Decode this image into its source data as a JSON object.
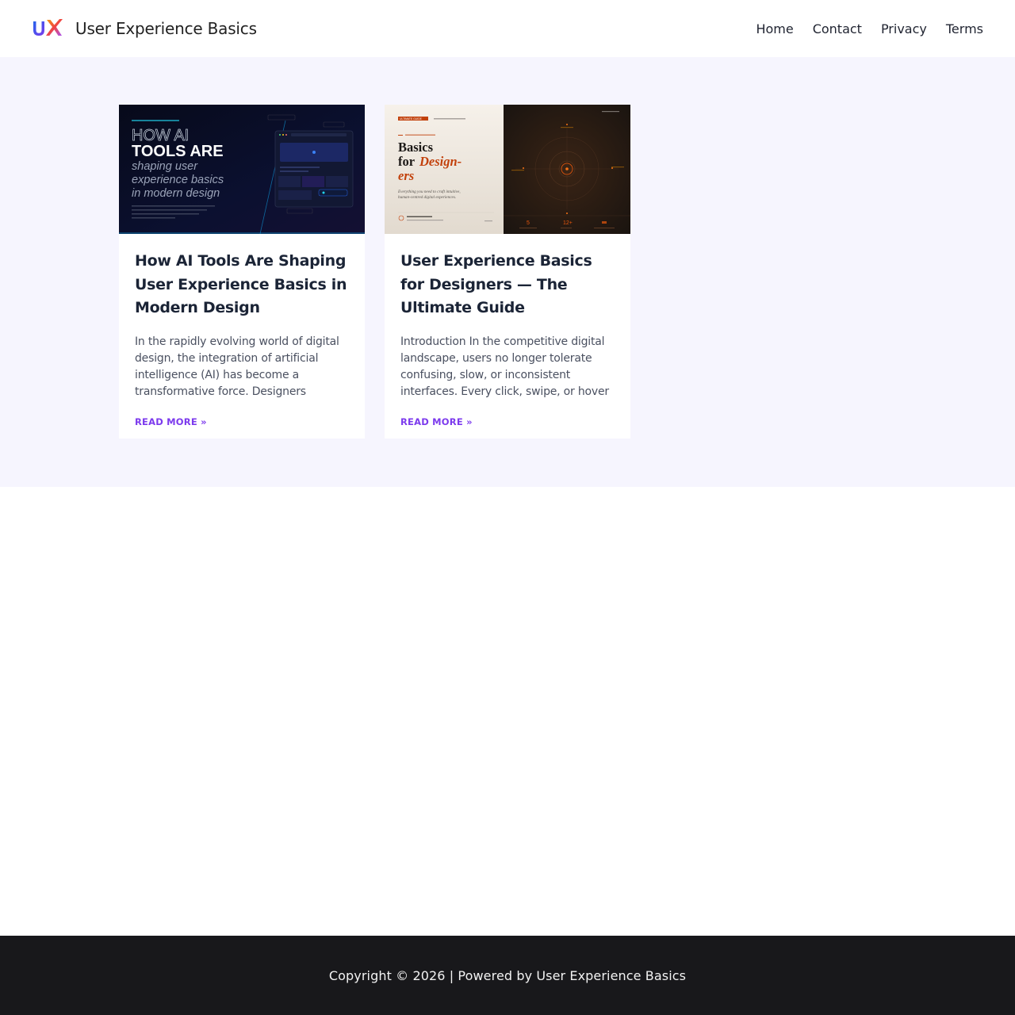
{
  "header": {
    "logo_text": "UX",
    "site_title": "User Experience Basics",
    "nav": [
      {
        "label": "Home"
      },
      {
        "label": "Contact"
      },
      {
        "label": "Privacy"
      },
      {
        "label": "Terms"
      }
    ]
  },
  "posts": [
    {
      "title": "How AI Tools Are Shaping User Experience Basics in Modern Design",
      "excerpt": "In the rapidly evolving world of digital design, the integration of artificial intelligence (AI) has become a transformative force. Designers",
      "read_more": "READ MORE »",
      "image": {
        "headline_outline": "HOW AI",
        "headline_bold": "TOOLS ARE",
        "headline_italic_1": "shaping user",
        "headline_italic_2": "experience basics",
        "headline_italic_3": "in modern design"
      }
    },
    {
      "title": "User Experience Basics for Designers — The Ultimate Guide",
      "excerpt": "Introduction In the competitive digital landscape, users no longer tolerate confusing, slow, or inconsistent interfaces. Every click, swipe, or hover",
      "read_more": "READ MORE »",
      "image": {
        "badge": "ULTIMATE GUIDE",
        "heading_1": "Basics",
        "heading_2": "for",
        "heading_3": "Design-",
        "heading_4": "ers",
        "subtext_1": "Everything you need to craft intuitive,",
        "subtext_2": "human-centred digital experiences.",
        "stat_1": "5",
        "stat_2": "12+"
      }
    }
  ],
  "footer": {
    "copyright": "Copyright © 2026 | Powered by User Experience Basics"
  },
  "colors": {
    "accent": "#7c3aed",
    "content_bg": "#f6f5fe",
    "footer_bg": "#18181b"
  }
}
